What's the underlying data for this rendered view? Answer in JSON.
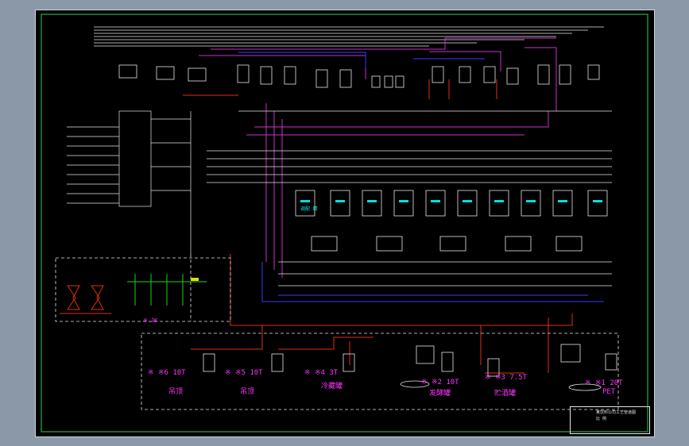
{
  "drawing": {
    "annotations": {
      "small_tank_upper": "调配 精",
      "bottom_tank_1": "※ ※6 10T",
      "bottom_tank_2": "※ ※5 10T",
      "bottom_tank_3": "※ ※4 3T",
      "bottom_tank_4": "※ ※2 10T",
      "bottom_tank_5": "※ ※3 7.5T",
      "bottom_tank_6": "※ ※1 20T",
      "label_a": "吊顶",
      "label_b": "吊顶",
      "label_c": "冷藏罐",
      "label_d": "发酵罐",
      "label_e": "贮酒罐",
      "label_f": "PET",
      "mid_left_tank": "※ 3K"
    },
    "title_block": {
      "line1": "某饮料公司工艺管道图",
      "line2": "比 例"
    },
    "colors": {
      "background": "#000000",
      "frame_border": "#1f8a3c",
      "pipe_white": "#e6e6e6",
      "pipe_magenta": "#c832c8",
      "pipe_red": "#e03010",
      "pipe_blue": "#3a3aff",
      "accent_cyan": "#00e0e0",
      "accent_green": "#20d020",
      "accent_yellow": "#e0e000"
    }
  }
}
